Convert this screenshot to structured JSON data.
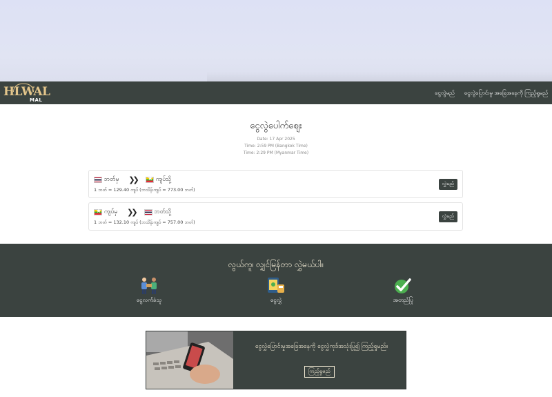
{
  "header": {
    "logo_main": "HLWAL",
    "logo_sub": "MAL",
    "nav": [
      {
        "label": "ငွေလွဲမည်"
      },
      {
        "label": "ငွေလွဲပြောင်းမှု အခြေအနေကို ကြည့်ရှုမည်"
      }
    ]
  },
  "rates_section": {
    "title": "ငွေလွဲပေါက်ဈေး",
    "date": "Date: 17 Apr 2025",
    "time_bangkok": "Time: 2:59 PM (Bangkok Time)",
    "time_myanmar": "Time: 2:29 PM (Myanmar Time)"
  },
  "cards": [
    {
      "from_flag": "thailand-flag-icon",
      "from_label": "ဘတ်မှ",
      "to_flag": "myanmar-flag-icon",
      "to_label": "ကျပ်သို့",
      "rate": "1 ဘတ် = 129.40 ကျပ် (ဘသိန်းကျပ် = 773.00 ဘတ်)",
      "button": "လွှဲမည်"
    },
    {
      "from_flag": "myanmar-flag-icon",
      "from_label": "ကျပ်မှ",
      "to_flag": "thailand-flag-icon",
      "to_label": "ဘတ်သို့",
      "rate": "1 ဘတ် = 132.10 ကျပ် (ဘသိန်းကျပ် = 757.00 ဘတ်)",
      "button": "လွှဲမည်"
    }
  ],
  "steps": {
    "title": "လွယ်ကူ၊ လျှင်မြန်တာ လွှဲမယ်ပါ။",
    "items": [
      {
        "icon": "people-exchange-icon",
        "label": "ငွေလက်ခံသူ"
      },
      {
        "icon": "money-transfer-icon",
        "label": "ငွေလွှဲ"
      },
      {
        "icon": "checkmark-icon",
        "label": "အတည်ပြု"
      }
    ]
  },
  "promo": {
    "text": "ငွေလွှဲပြောင်းမှုအခြေအနေကို ငွေလွှဲကုဒ်အသုံးပြု၍ ကြည့်ရှုမည်။",
    "button": "ကြည့်ရှုမည်"
  },
  "colors": {
    "nav_bg": "#3b4340",
    "accent_gold": "#e3c58b",
    "hero_bg": "#dde1f5"
  }
}
